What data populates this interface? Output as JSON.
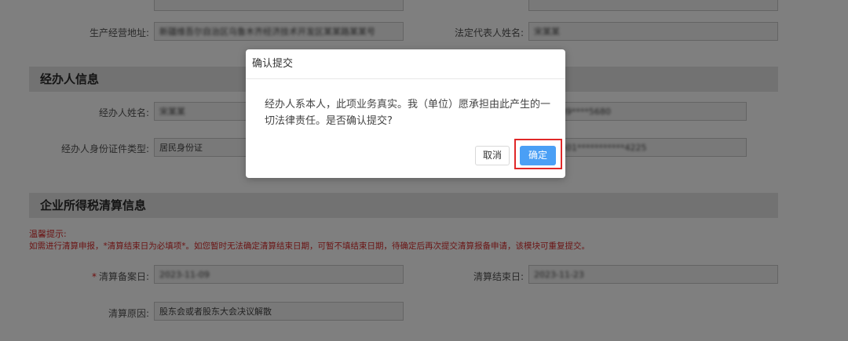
{
  "form": {
    "row_production": {
      "address_label": "生产经营地址:",
      "address_value": "新疆维吾尔自治区乌鲁木齐经济技术开发区某某路某某号",
      "legal_rep_label": "法定代表人姓名:",
      "legal_rep_value": "宋某某"
    },
    "agent_section": {
      "title": "经办人信息",
      "name_label": "经办人姓名:",
      "name_value": "宋某某",
      "phone_value": "139****5680",
      "id_type_label": "经办人身份证件类型:",
      "id_type_value": "居民身份证",
      "id_number_value": "6501***********4225"
    },
    "tax_section": {
      "title": "企业所得税清算信息",
      "tip_title": "温馨提示:",
      "tip_text": "如需进行清算申报，*清算结束日为必填项*。如您暂时无法确定清算结束日期，可暂不填结束日期，待确定后再次提交清算报备申请，该模块可重复提交。",
      "required_mark": "*",
      "filing_date_label": "清算备案日:",
      "filing_date_value": "2023-11-09",
      "end_date_label": "清算结束日:",
      "end_date_value": "2023-11-23",
      "reason_label": "清算原因:",
      "reason_value": "股东会或者股东大会决议解散"
    }
  },
  "dialog": {
    "title": "确认提交",
    "message": "经办人系本人，此项业务真实。我（单位）愿承担由此产生的一切法律责任。是否确认提交?",
    "cancel_label": "取消",
    "confirm_label": "确定"
  },
  "colors": {
    "confirm_button": "#4a9ff5",
    "highlight_border": "#e02828",
    "warning_text": "#d62a2a",
    "section_bg": "#e4e4e4"
  }
}
